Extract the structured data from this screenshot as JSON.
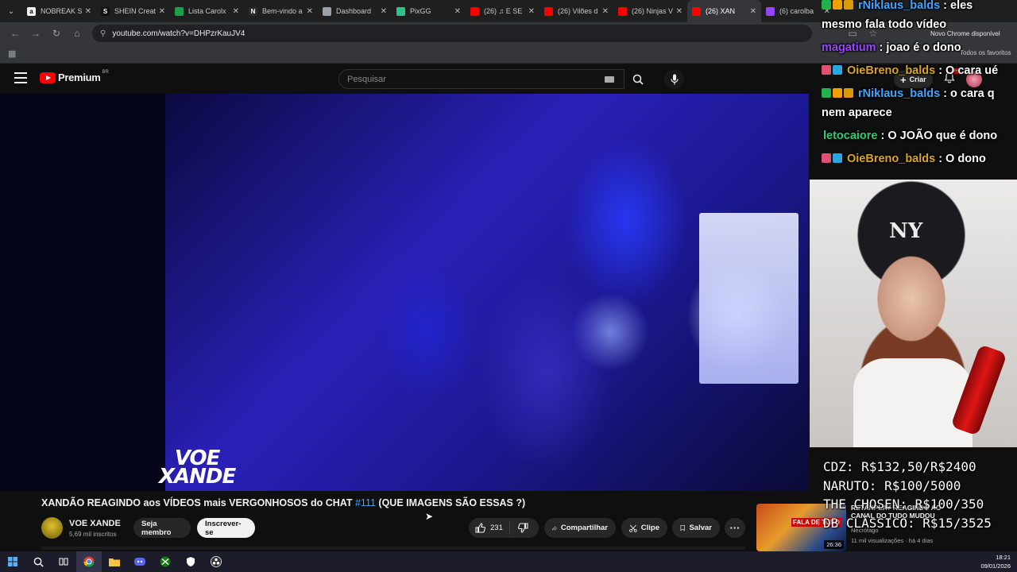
{
  "browser": {
    "tabs": [
      {
        "label": "NOBREAK S",
        "favicon_color": "#f2f2f2",
        "favicon_glyph": "a",
        "active": false
      },
      {
        "label": "SHEIN Creat",
        "favicon_color": "#111111",
        "favicon_glyph": "S",
        "active": false
      },
      {
        "label": "Lista Carolx",
        "favicon_color": "#1e9e4a",
        "favicon_glyph": "",
        "active": false
      },
      {
        "label": "Bem-vindo a",
        "favicon_color": "#2b2b2b",
        "favicon_glyph": "N",
        "active": false
      },
      {
        "label": "Dashboard",
        "favicon_color": "#9aa0a6",
        "favicon_glyph": "",
        "active": false
      },
      {
        "label": "PixGG",
        "favicon_color": "#2dc38b",
        "favicon_glyph": "",
        "active": false
      },
      {
        "label": "(26) ♫ E SE",
        "favicon_color": "#ff0000",
        "favicon_glyph": "",
        "active": false
      },
      {
        "label": "(26) Vilões d",
        "favicon_color": "#ff0000",
        "favicon_glyph": "",
        "active": false
      },
      {
        "label": "(26) Ninjas V",
        "favicon_color": "#ff0000",
        "favicon_glyph": "",
        "active": false
      },
      {
        "label": "(26) XAN",
        "favicon_color": "#ff0000",
        "favicon_glyph": "",
        "active": true
      },
      {
        "label": "(6) carolba",
        "favicon_color": "#9146ff",
        "favicon_glyph": "",
        "active": false
      }
    ],
    "url": "youtube.com/watch?v=DHPzrKauJV4",
    "chrome_update": "Novo Chrome disponível",
    "favorites_label": "Todos os favoritos"
  },
  "youtube": {
    "logo_text": "Premium",
    "country_code": "BR",
    "search_placeholder": "Pesquisar",
    "create_label": "Criar",
    "notifications_count": "9+",
    "video_watermark_line1": "VOE",
    "video_watermark_line2": "XANDE",
    "video_title_main": "XANDÃO REAGINDO aos VÍDEOS mais VERGONHOSOS do CHAT",
    "video_title_tag": "#111",
    "video_title_end": "(QUE IMAGENS SÃO ESSAS ?)",
    "channel_name": "VOE XANDE",
    "channel_subs": "5,69 mil inscritos",
    "member_button": "Seja membro",
    "subscribe_button": "Inscrever-se",
    "like_count": "231",
    "share_label": "Compartilhar",
    "clip_label": "Clipe",
    "save_label": "Salvar",
    "more_label": "···",
    "recommended": {
      "title": "RETANPLAY REAGINDO AO CANAL DO TUDO MUDOU",
      "channel": "Necrófago",
      "meta": "11 mil visualizações · há 4 dias",
      "duration": "26:36",
      "thumb_text": "FALA DE TUDO"
    }
  },
  "chat": [
    {
      "user": "rNiklaus_balds",
      "message": ": eles",
      "color": "#3ea6ff",
      "badges": [
        "#22b14c",
        "#f0a000",
        "#d99b00"
      ]
    },
    {
      "user": "",
      "message": "mesmo fala todo vídeo",
      "color": "#ffffff",
      "badges": []
    },
    {
      "user": "magatium",
      "message": ": joao é o dono",
      "color": "#9b45ff",
      "badges": []
    },
    {
      "user": "OieBreno_balds",
      "message": ": O cara ué",
      "color": "#daa520",
      "badges": [
        "#e05070",
        "#2aa7e0"
      ]
    },
    {
      "user": "rNiklaus_balds",
      "message": ": o cara q",
      "color": "#3ea6ff",
      "badges": [
        "#22b14c",
        "#f0a000",
        "#d99b00"
      ]
    },
    {
      "user": "",
      "message": "nem aparece",
      "color": "#ffffff",
      "badges": []
    },
    {
      "user": "letocaiore",
      "message": ": O JOÃO que é dono",
      "color": "#2ecc71",
      "badges": []
    },
    {
      "user": "OieBreno_balds",
      "message": ": O dono",
      "color": "#daa520",
      "badges": [
        "#e05070",
        "#2aa7e0"
      ]
    }
  ],
  "webcam": {
    "cap_logo": "NY"
  },
  "prices": [
    "CDZ: R$132,50/R$2400",
    "NARUTO: R$100/5000",
    "THE CHOSEN: R$100/350",
    "DB CLÁSSICO: R$15/3525"
  ],
  "taskbar": {
    "time": "18:21",
    "date": "09/01/2026"
  }
}
